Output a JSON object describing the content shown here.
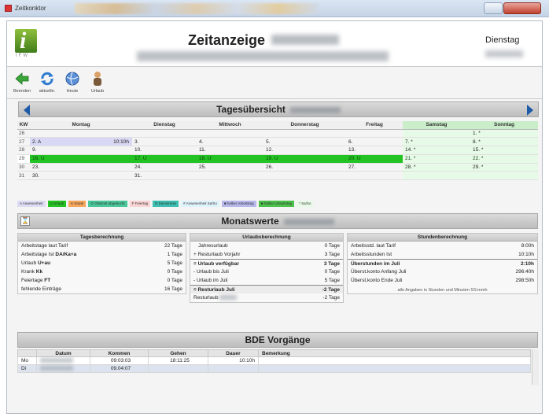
{
  "window": {
    "title": "Zeitkonktor"
  },
  "header": {
    "title": "Zeitanzeige",
    "weekday": "Dienstag",
    "logo_text": "IFW"
  },
  "toolbar": [
    {
      "label": "Beenden",
      "icon": "exit-arrow-icon"
    },
    {
      "label": "aktuelle.",
      "icon": "refresh-icon"
    },
    {
      "label": "Heute",
      "icon": "globe-icon"
    },
    {
      "label": "Urlaub",
      "icon": "person-icon"
    }
  ],
  "tages": {
    "title": "Tagesübersicht",
    "headers": [
      "KW",
      "Montag",
      "Dienstag",
      "Mittwoch",
      "Donnerstag",
      "Freitag",
      "Samstag",
      "Sonntag"
    ],
    "rows": [
      {
        "kw": "26",
        "cells": [
          "",
          "",
          "",
          "",
          "",
          "",
          "1. *"
        ]
      },
      {
        "kw": "27",
        "cells": [
          "2. A",
          "3.",
          "4.",
          "5.",
          "6.",
          "7. *",
          "8. *"
        ],
        "mon_extra": "10:10h"
      },
      {
        "kw": "28",
        "cells": [
          "9.",
          "10.",
          "11.",
          "12.",
          "13.",
          "14. *",
          "15. *"
        ]
      },
      {
        "kw": "29",
        "cells": [
          "16. U",
          "17. U",
          "18. U",
          "19. U",
          "20. U",
          "21. *",
          "22. *"
        ],
        "highlight": true
      },
      {
        "kw": "30",
        "cells": [
          "23.",
          "24.",
          "25.",
          "26.",
          "27.",
          "28. *",
          "29. *"
        ]
      },
      {
        "kw": "31",
        "cells": [
          "30.",
          "31.",
          "",
          "",
          "",
          "",
          ""
        ]
      }
    ],
    "legend": [
      {
        "label": "A Anwesenheit",
        "color": "#dcdcf5"
      },
      {
        "label": "U Urlaub",
        "color": "#22c322"
      },
      {
        "label": "K Krank",
        "color": "#f5a65b"
      },
      {
        "label": "G Gleitzeit abgebucht",
        "color": "#49c89a"
      },
      {
        "label": "F Feiertag",
        "color": "#f9d4d4"
      },
      {
        "label": "D Dienstreise",
        "color": "#3cbfb0"
      },
      {
        "label": "# Anwesenheit Sa/So",
        "color": "#dff3fb"
      },
      {
        "label": "■ halber Arbeitstag",
        "color": "#b8b8ec"
      },
      {
        "label": "■ halber Urlaubstag",
        "color": "#4cc24c"
      },
      {
        "label": "* Sa/So",
        "color": "#e7fae7"
      }
    ]
  },
  "monat": {
    "title": "Monatswerte",
    "tages": {
      "title": "Tagesberechnung",
      "rows": [
        {
          "label": "Arbeitstage laut Tarif",
          "value": "22 Tage"
        },
        {
          "label": "Arbeitstage Ist",
          "strong": "DA/Ka+a",
          "value": "1 Tage"
        },
        {
          "label": "Urlaub",
          "strong": "U+au",
          "value": "5 Tage"
        },
        {
          "label": "Krank",
          "strong": "Kk",
          "value": "0 Tage"
        },
        {
          "label": "Feiertage",
          "strong": "FT",
          "value": "0 Tage"
        },
        {
          "label": "fehlende Einträge",
          "value": "16 Tage"
        }
      ]
    },
    "urlaub": {
      "title": "Urlaubsberechnung",
      "rows": [
        {
          "label": "Jahresurlaub",
          "value": "0 Tage"
        },
        {
          "label": "+ Resturlaub Vorjahr",
          "value": "3 Tage"
        },
        {
          "label": "= Urlaub verfügbar",
          "value": "3 Tage",
          "bold": true,
          "sep": true
        },
        {
          "label": "- Urlaub bis Juli",
          "value": "0 Tage"
        },
        {
          "label": "- Urlaub im Juli",
          "value": "5 Tage"
        },
        {
          "label": "= Resturlaub Juli",
          "value": "-2 Tage",
          "bold": true,
          "sep": true
        },
        {
          "label": "Resturlaub",
          "value": "-2 Tage"
        }
      ]
    },
    "stunden": {
      "title": "Stundenberechnung",
      "rows": [
        {
          "label": "Arbeitsstd. laut Tarif",
          "value": "8:00h"
        },
        {
          "label": "Arbeitsstunden Ist",
          "value": "10:10h"
        },
        {
          "label": "Überstunden im Juli",
          "value": "2:10h",
          "bold": true,
          "sep": true
        },
        {
          "label": "Überst.konto Anfang Juli",
          "value": "296:40h"
        },
        {
          "label": "Überst.konto Ende Juli",
          "value": "298:50h"
        }
      ],
      "note": "alle Angaben in Stunden und Minuten SS:mmh"
    }
  },
  "bde": {
    "title": "BDE Vorgänge",
    "headers": [
      "Datum",
      "Kommen",
      "Gehen",
      "Dauer",
      "Bemerkung"
    ],
    "rows": [
      {
        "day": "Mo",
        "kommen": "09:03:03",
        "gehen": "18:11:25",
        "dauer": "10:10h",
        "bem": ""
      },
      {
        "day": "Di",
        "kommen": "09.04:07",
        "gehen": "",
        "dauer": "",
        "bem": ""
      }
    ]
  },
  "colors": {
    "urlaub": "#22c322",
    "weekend": "#e7fae7",
    "accent": "#1f5aa8"
  }
}
